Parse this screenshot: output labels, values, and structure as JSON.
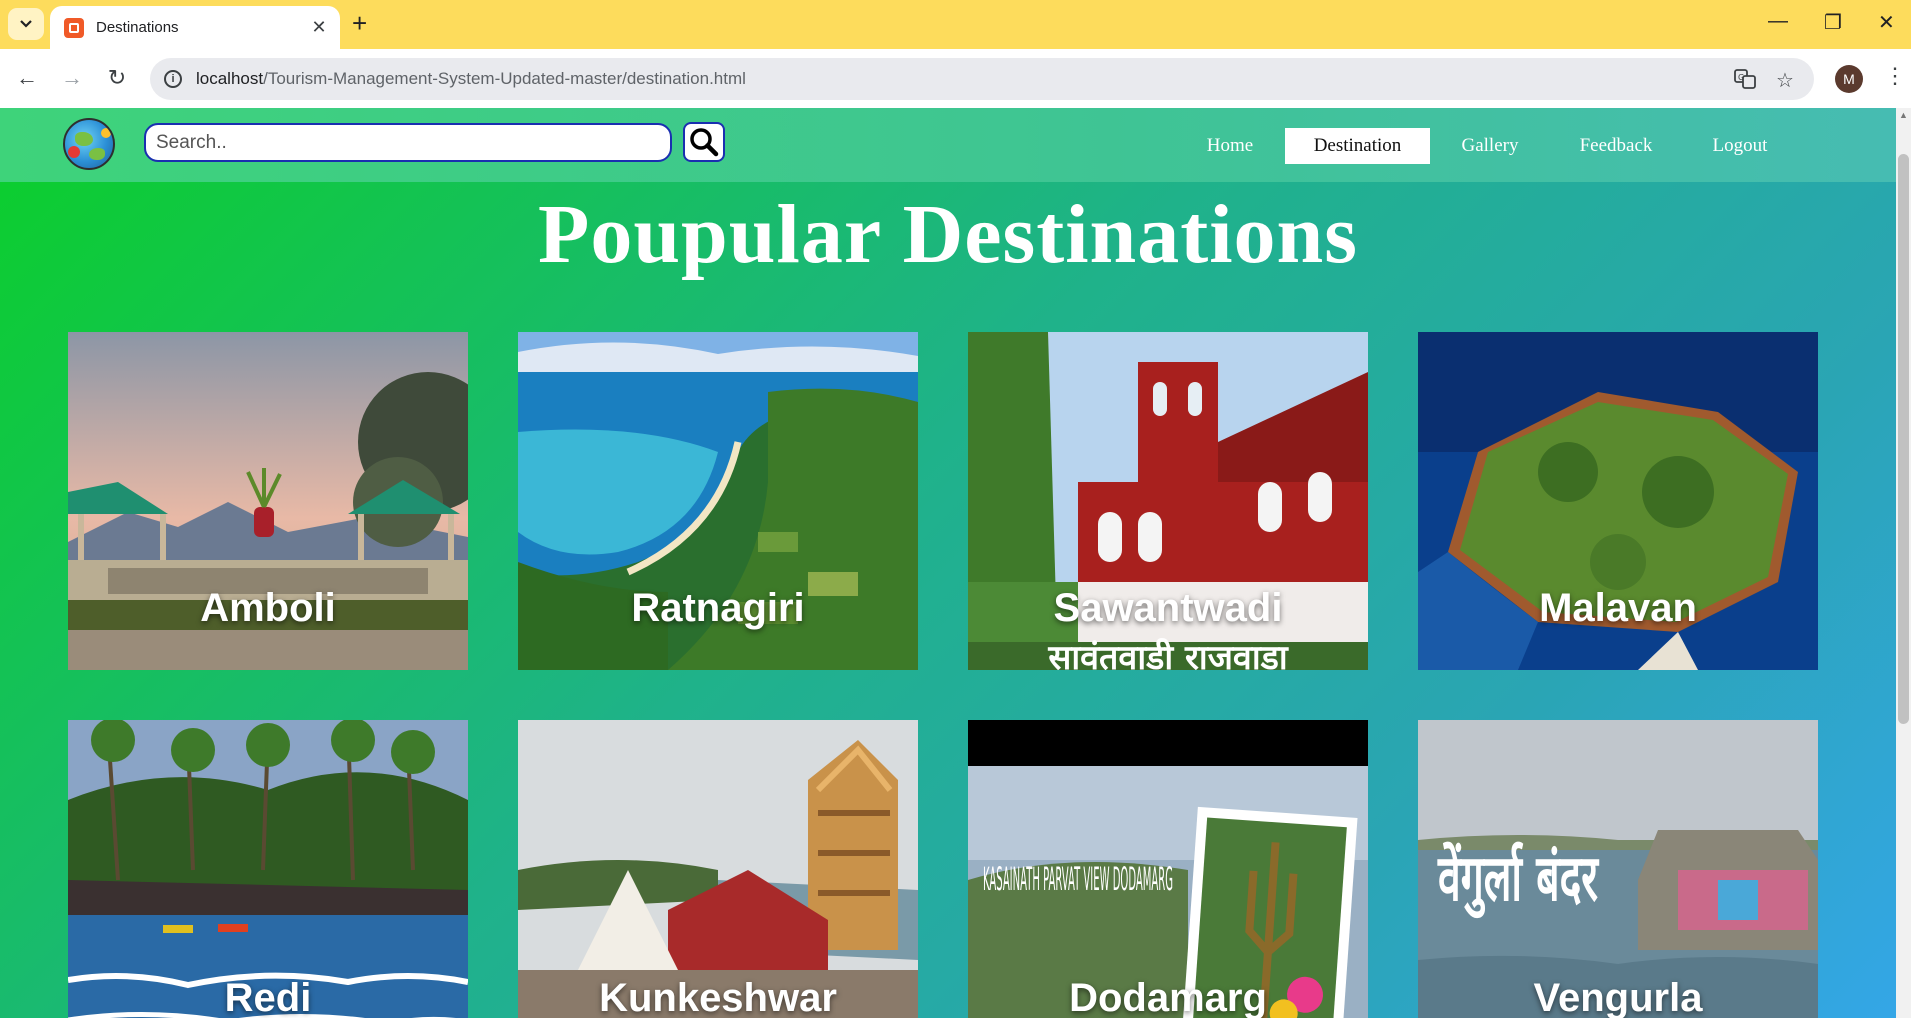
{
  "browser": {
    "tab_title": "Destinations",
    "url_host": "localhost",
    "url_path": "/Tourism-Management-System-Updated-master/destination.html",
    "avatar_letter": "M"
  },
  "nav": {
    "search_placeholder": "Search..",
    "items": [
      {
        "label": "Home",
        "active": false
      },
      {
        "label": "Destination",
        "active": true
      },
      {
        "label": "Gallery",
        "active": false
      },
      {
        "label": "Feedback",
        "active": false
      },
      {
        "label": "Logout",
        "active": false
      }
    ]
  },
  "page_title": "Poupular Destinations",
  "destinations": [
    {
      "name": "Amboli"
    },
    {
      "name": "Ratnagiri"
    },
    {
      "name": "Sawantwadi",
      "image_text": "सावंतवाडी राजवाडा"
    },
    {
      "name": "Malavan"
    },
    {
      "name": "Redi"
    },
    {
      "name": "Kunkeshwar"
    },
    {
      "name": "Dodamarg",
      "image_text": "KASAINATH PARVAT VIEW DODAMARG"
    },
    {
      "name": "Vengurla",
      "image_text": "वेंगुर्ला बंदर"
    }
  ],
  "colors": {
    "tab_strip": "#fddc5c",
    "nav_border": "#1a2fb0",
    "page_gradient_start": "#0bcf2a",
    "page_gradient_end": "#34a6e8"
  }
}
